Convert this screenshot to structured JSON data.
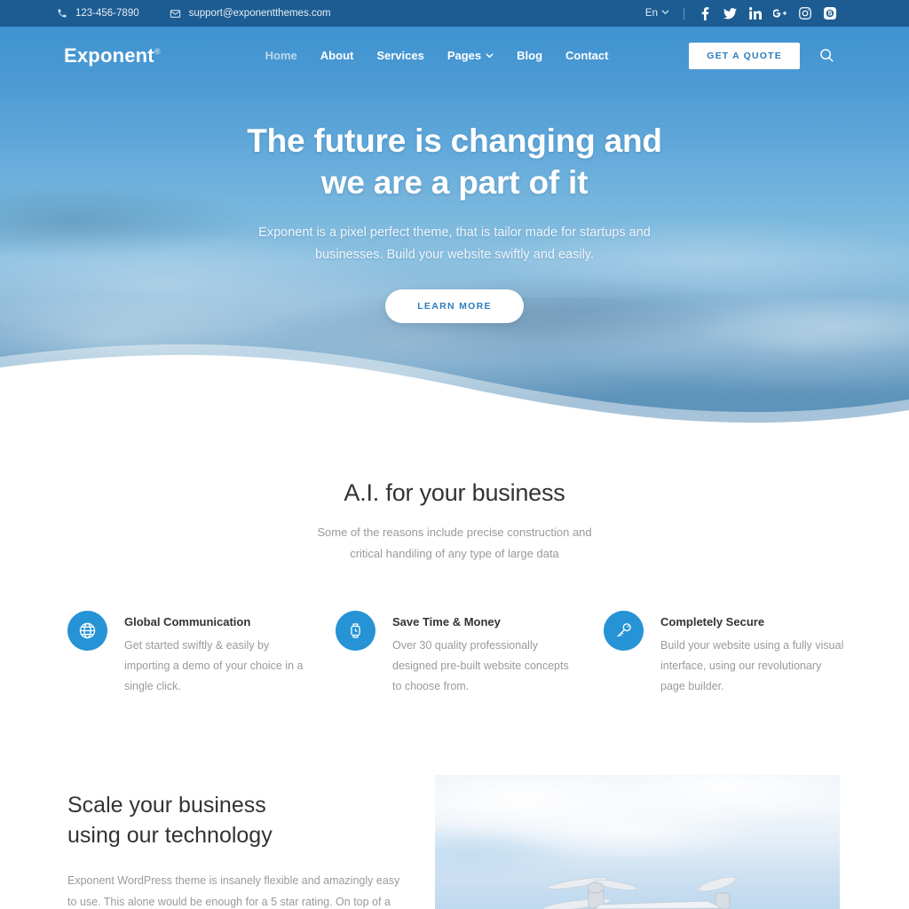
{
  "topbar": {
    "phone": "123-456-7890",
    "email": "support@exponentthemes.com",
    "language": "En",
    "socials": [
      "facebook-icon",
      "twitter-icon",
      "linkedin-icon",
      "googleplus-icon",
      "instagram-icon",
      "skype-icon"
    ],
    "bg_color": "#1c5c92"
  },
  "nav": {
    "logo": "Exponent",
    "logo_mark": "®",
    "items": [
      {
        "label": "Home",
        "active": true,
        "has_dropdown": false
      },
      {
        "label": "About",
        "active": false,
        "has_dropdown": false
      },
      {
        "label": "Services",
        "active": false,
        "has_dropdown": false
      },
      {
        "label": "Pages",
        "active": false,
        "has_dropdown": true
      },
      {
        "label": "Blog",
        "active": false,
        "has_dropdown": false
      },
      {
        "label": "Contact",
        "active": false,
        "has_dropdown": false
      }
    ],
    "quote_label": "GET A QUOTE",
    "search_icon": "search-icon"
  },
  "hero": {
    "title_line1": "The future is changing and",
    "title_line2": "we are a part of it",
    "subtitle": "Exponent is a pixel perfect theme, that is tailor made for startups and businesses. Build your website swiftly and easily.",
    "cta_label": "LEARN MORE",
    "accent_color": "#2b7cc0"
  },
  "ai_section": {
    "title": "A.I. for your business",
    "subtitle": "Some of the reasons include precise construction and critical handiling of any type of large data"
  },
  "features": [
    {
      "icon": "globe-icon",
      "title": "Global Communication",
      "text": "Get started swiftly & easily by importing a demo of your choice in a single click."
    },
    {
      "icon": "watch-icon",
      "title": "Save Time & Money",
      "text": "Over 30 quality professionally designed pre-built website concepts to choose from."
    },
    {
      "icon": "key-icon",
      "title": "Completely Secure",
      "text": "Build your website using a fully visual interface, using our revolutionary page builder."
    }
  ],
  "scale_section": {
    "title_line1": "Scale your business",
    "title_line2": "using our technology",
    "text": "Exponent WordPress theme is insanely flexible and amazingly easy to use. This alone would be enough for a 5 star rating. On top of a",
    "image_alt": "drone-flying-in-sky-photo"
  },
  "colors": {
    "icon_circle": "#2693d6",
    "heading": "#333333",
    "body_text": "#9a9a9a"
  }
}
